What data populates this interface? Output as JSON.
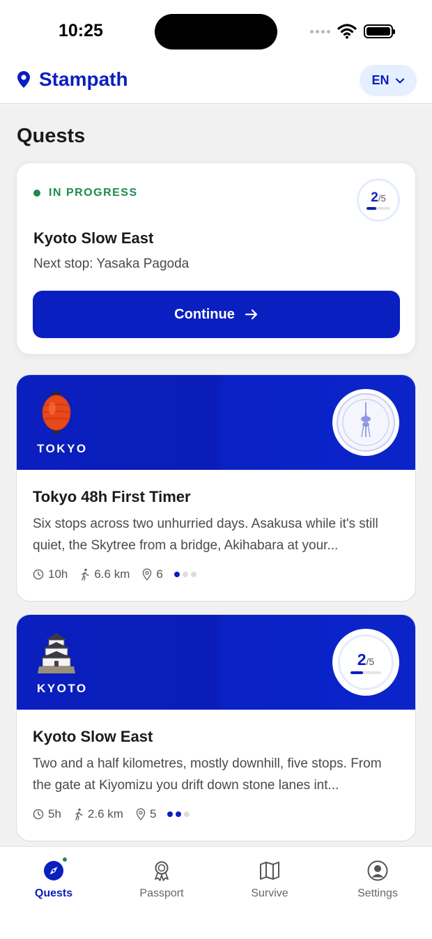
{
  "status_bar": {
    "time": "10:25"
  },
  "header": {
    "brand": "Stampath",
    "language": "EN"
  },
  "page": {
    "title": "Quests"
  },
  "in_progress": {
    "status": "IN PROGRESS",
    "progress_current": "2",
    "progress_total": "/5",
    "progress_fraction": 0.4,
    "title": "Kyoto Slow East",
    "next_stop": "Next stop: Yasaka Pagoda",
    "continue_label": "Continue"
  },
  "quests": [
    {
      "city": "TOKYO",
      "stamp_text": "TOKYO",
      "title": "Tokyo 48h First Timer",
      "description": "Six stops across two unhurried days. Asakusa while it's still quiet, the Skytree from a bridge, Akihabara at your...",
      "duration": "10h",
      "distance": "6.6 km",
      "stops": "6",
      "difficulty_level": 1
    },
    {
      "city": "KYOTO",
      "progress_current": "2",
      "progress_total": "/5",
      "progress_fraction": 0.4,
      "title": "Kyoto Slow East",
      "description": "Two and a half kilometres, mostly downhill, five stops. From the gate at Kiyomizu you drift down stone lanes int...",
      "duration": "5h",
      "distance": "2.6 km",
      "stops": "5",
      "difficulty_level": 2
    }
  ],
  "tabs": [
    {
      "label": "Quests",
      "icon": "compass-icon",
      "active": true
    },
    {
      "label": "Passport",
      "icon": "badge-icon",
      "active": false
    },
    {
      "label": "Survive",
      "icon": "map-icon",
      "active": false
    },
    {
      "label": "Settings",
      "icon": "user-circle-icon",
      "active": false
    }
  ],
  "colors": {
    "accent": "#0a1fbf",
    "success": "#1e8a4d",
    "background": "#f1f1f1"
  }
}
